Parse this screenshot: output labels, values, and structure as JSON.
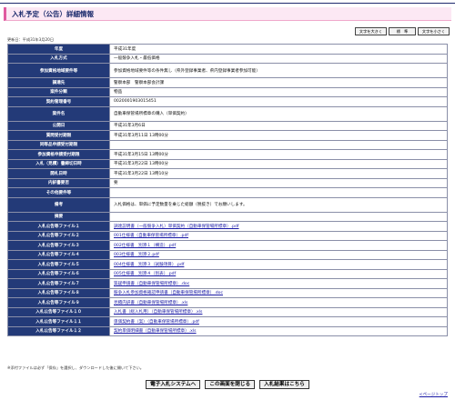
{
  "header": {
    "title": "入札予定（公告）詳細情報"
  },
  "size_buttons": {
    "large": "文字を大きく",
    "standard": "標　準",
    "small": "文字を小さく"
  },
  "updated": "更新日：平成31年3月20日",
  "rows": [
    {
      "label": "年度",
      "value": "平成31年度"
    },
    {
      "label": "入札方式",
      "value": "一般競争入札・最低価格"
    },
    {
      "label": "参加資格地域要件等",
      "value": "参加資格地域要件等の条件無し（県外登録事業者、県内登録事業者参加可能）"
    },
    {
      "label": "調達先",
      "value": "警察本部　警察本部会計課"
    },
    {
      "label": "案件分類",
      "value": "物品"
    },
    {
      "label": "契約管理番号",
      "value": "0020001903015451"
    },
    {
      "label": "案件名",
      "value": "自動車保管場所標章の購入（単価契約）"
    },
    {
      "label": "公開日",
      "value": "平成31年3月6日"
    },
    {
      "label": "質問受付期限",
      "value": "平成31年3月11日 13時00分"
    },
    {
      "label": "同等品申請受付期限",
      "value": ""
    },
    {
      "label": "参加資格申請受付期限",
      "value": "平成31年3月15日 13時00分"
    },
    {
      "label": "入札（見積）書締切日時",
      "value": "平成31年3月22日 13時00分"
    },
    {
      "label": "開札日時",
      "value": "平成31年3月22日 13時10分"
    },
    {
      "label": "内訳書要否",
      "value": "要"
    },
    {
      "label": "その他要件等",
      "value": ""
    },
    {
      "label": "備考",
      "value": "入札価格は、単価に予定数量を乗じた総額（税抜き）でお願いします。"
    },
    {
      "label": "摘要",
      "value": ""
    },
    {
      "label": "入札公告等ファイル１",
      "value": "調達説明書（一般競争入札）単価契約（自動車保管場所標章）.pdf",
      "link": true
    },
    {
      "label": "入札公告等ファイル２",
      "value": "001仕様書（自動車保管場所標章）.pdf",
      "link": true
    },
    {
      "label": "入札公告等ファイル３",
      "value": "002仕様書　別添１（構造）.pdf",
      "link": true
    },
    {
      "label": "入札公告等ファイル４",
      "value": "003仕様書　別添２.pdf",
      "link": true
    },
    {
      "label": "入札公告等ファイル５",
      "value": "004仕様書　別添３（試験項目）.pdf",
      "link": true
    },
    {
      "label": "入札公告等ファイル６",
      "value": "005仕様書　別添４（別表）.pdf",
      "link": true
    },
    {
      "label": "入札公告等ファイル７",
      "value": "質疑申請書（自動車保管場所標章）.doc",
      "link": true
    },
    {
      "label": "入札公告等ファイル８",
      "value": "競争入札参加資格確認申請書（自動車保管場所標章）.doc",
      "link": true
    },
    {
      "label": "入札公告等ファイル９",
      "value": "見積内訳書（自動車保管場所標章）.xls",
      "link": true
    },
    {
      "label": "入札公告等ファイル１０",
      "value": "入札書（総入札用）（自動車保管場所標章）.xls",
      "link": true
    },
    {
      "label": "入札公告等ファイル１１",
      "value": "単価契約書（案）（自動車保管場所標章）.pdf",
      "link": true
    },
    {
      "label": "入札公告等ファイル１２",
      "value": "契約単価明細書（自動車保管場所標章）.xls",
      "link": true
    }
  ],
  "note": "※添付ファイルは必ず「保存」を選択し、ダウンロードした後に開いて下さい。",
  "bottom_buttons": {
    "system": "電子入札システムへ",
    "close": "この画面を閉じる",
    "results": "入札結果はこちら"
  },
  "page_top": "<ページトップ"
}
